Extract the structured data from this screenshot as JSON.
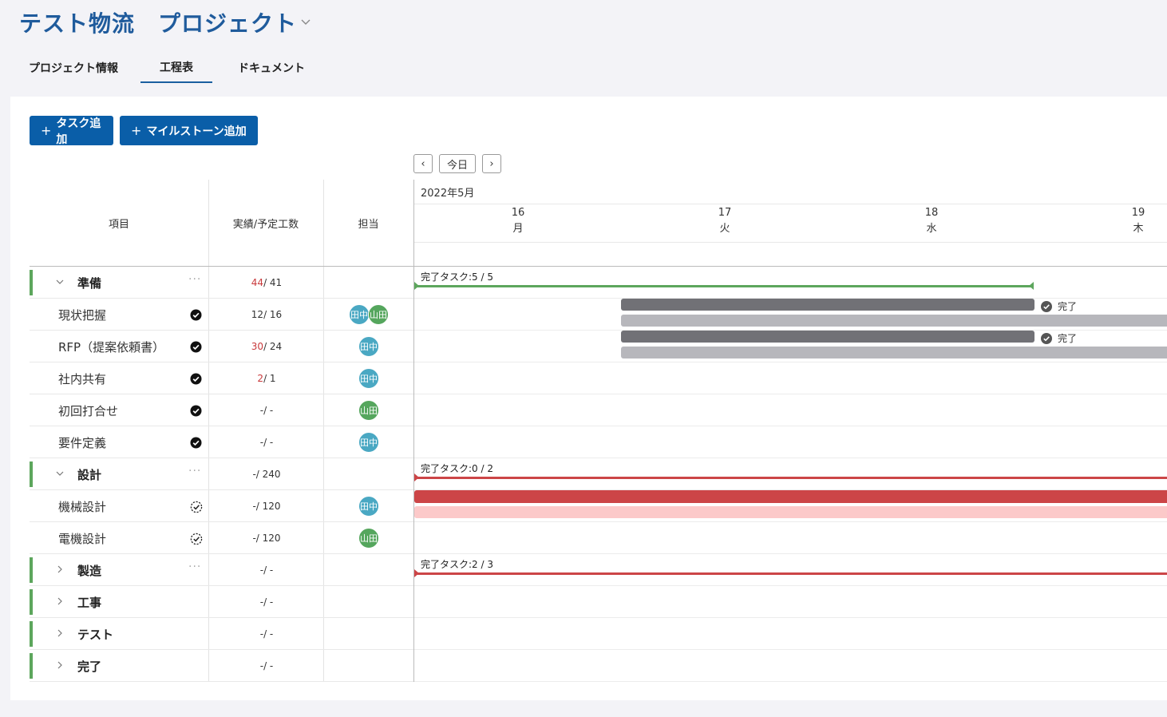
{
  "project": {
    "title": "テスト物流　プロジェクト"
  },
  "tabs": [
    {
      "label": "プロジェクト情報"
    },
    {
      "label": "工程表",
      "active": true
    },
    {
      "label": "ドキュメント"
    }
  ],
  "toolbar": {
    "add_task": "タスク追加",
    "add_milestone": "マイルストーン追加",
    "plus": "+",
    "prev": "‹",
    "today": "今日",
    "next": "›"
  },
  "columns": {
    "item": "項目",
    "effort": "実績/予定工数",
    "assignee": "担当"
  },
  "gantt": {
    "month": "2022年5月",
    "days": [
      {
        "day": "16",
        "weekday": "月"
      },
      {
        "day": "17",
        "weekday": "火"
      },
      {
        "day": "18",
        "weekday": "水"
      },
      {
        "day": "19",
        "weekday": "木"
      }
    ],
    "done_label": "完了",
    "groups": {
      "junbi": "完了タスク:5 / 5",
      "sekkei": "完了タスク:0 / 2",
      "seizou": "完了タスク:2 / 3"
    }
  },
  "rows": [
    {
      "kind": "group",
      "name": "準備",
      "actual": "44",
      "planned": " / 41",
      "actual_over": true
    },
    {
      "kind": "task",
      "name": "現状把握",
      "status": "done",
      "actual": "12",
      "planned": " / 16",
      "actual_over": false,
      "assignees": [
        "田中",
        "山田"
      ]
    },
    {
      "kind": "task",
      "name": "RFP（提案依頼書）",
      "status": "done",
      "actual": "30",
      "planned": " / 24",
      "actual_over": true,
      "assignees": [
        "田中"
      ]
    },
    {
      "kind": "task",
      "name": "社内共有",
      "status": "done",
      "actual": "2",
      "planned": " / 1",
      "actual_over": true,
      "assignees": [
        "田中"
      ]
    },
    {
      "kind": "task",
      "name": "初回打合せ",
      "status": "done",
      "actual": "-",
      "planned": " / -",
      "actual_over": false,
      "assignees": [
        "山田"
      ]
    },
    {
      "kind": "task",
      "name": "要件定義",
      "status": "done",
      "actual": "-",
      "planned": " / -",
      "actual_over": false,
      "assignees": [
        "田中"
      ]
    },
    {
      "kind": "group",
      "name": "設計",
      "actual": "-",
      "planned": " / 240",
      "actual_over": false
    },
    {
      "kind": "task",
      "name": "機械設計",
      "status": "in-progress",
      "actual": "-",
      "planned": " / 120",
      "actual_over": false,
      "assignees": [
        "田中"
      ]
    },
    {
      "kind": "task",
      "name": "電機設計",
      "status": "in-progress",
      "actual": "-",
      "planned": " / 120",
      "actual_over": false,
      "assignees": [
        "山田"
      ]
    },
    {
      "kind": "group",
      "name": "製造",
      "actual": "-",
      "planned": " / -",
      "actual_over": false
    },
    {
      "kind": "group",
      "name": "工事",
      "actual": "-",
      "planned": " / -",
      "actual_over": false
    },
    {
      "kind": "group",
      "name": "テスト",
      "actual": "-",
      "planned": " / -",
      "actual_over": false
    },
    {
      "kind": "group",
      "name": "完了",
      "actual": "-",
      "planned": " / -",
      "actual_over": false
    }
  ],
  "colors": {
    "primary": "#0a5ea8",
    "title": "#1f5b9c",
    "group_done": "#5da65d",
    "group_late": "#cc4547",
    "bar_actual": "#717176",
    "bar_plan": "#b7b7bc",
    "bar_late": "#cc4547",
    "bar_late_plan": "#fcc9c9",
    "avatar_tanaka": "#4aa8c3",
    "avatar_yamada": "#55a65d"
  }
}
